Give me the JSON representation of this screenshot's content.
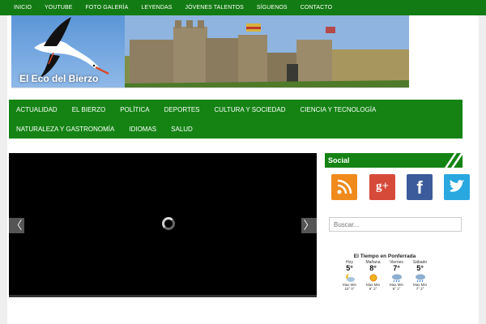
{
  "topnav": {
    "items": [
      "Inicio",
      "YouTube",
      "Foto Galería",
      "Leyendas",
      "Jóvenes Talentos",
      "Síguenos",
      "Contacto"
    ]
  },
  "banner": {
    "brand": "El Eco del Bierzo"
  },
  "mainnav": {
    "row1": [
      "Actualidad",
      "El Bierzo",
      "Política",
      "Deportes",
      "Cultura y Sociedad",
      "Ciencia y Tecnología"
    ],
    "row2": [
      "Naturaleza y Gastronomía",
      "Idiomas",
      "Salud"
    ]
  },
  "slider": {
    "prev": "〈",
    "next": "〉"
  },
  "sidebar": {
    "social_title": "Social",
    "icons": [
      {
        "name": "rss-icon",
        "color": "#ef8a1c",
        "glyph": ")"
      },
      {
        "name": "google-plus-icon",
        "color": "#d64a3a",
        "glyph": "g+"
      },
      {
        "name": "facebook-icon",
        "color": "#3b5b9a",
        "glyph": "f"
      },
      {
        "name": "twitter-icon",
        "color": "#29a8e0",
        "glyph": "t"
      }
    ],
    "search_placeholder": "Buscar..."
  },
  "weather": {
    "title": "El Tiempo en Ponferrada",
    "days": [
      {
        "day": "Hoy",
        "temp": "5°",
        "icon": "moon-cloud-icon",
        "mm": "Max Min",
        "vals": "10° 0°"
      },
      {
        "day": "Mañana",
        "temp": "8°",
        "icon": "sun-icon",
        "mm": "Max Min",
        "vals": "9° 2°"
      },
      {
        "day": "Viernes",
        "temp": "7°",
        "icon": "rain-icon",
        "mm": "Max Min",
        "vals": "9° 1°"
      },
      {
        "day": "Sábado",
        "temp": "5°",
        "icon": "rain-icon",
        "mm": "Max Min",
        "vals": "7° 2°"
      }
    ]
  },
  "colors": {
    "green": "#148314",
    "topbar": "#137b13"
  }
}
